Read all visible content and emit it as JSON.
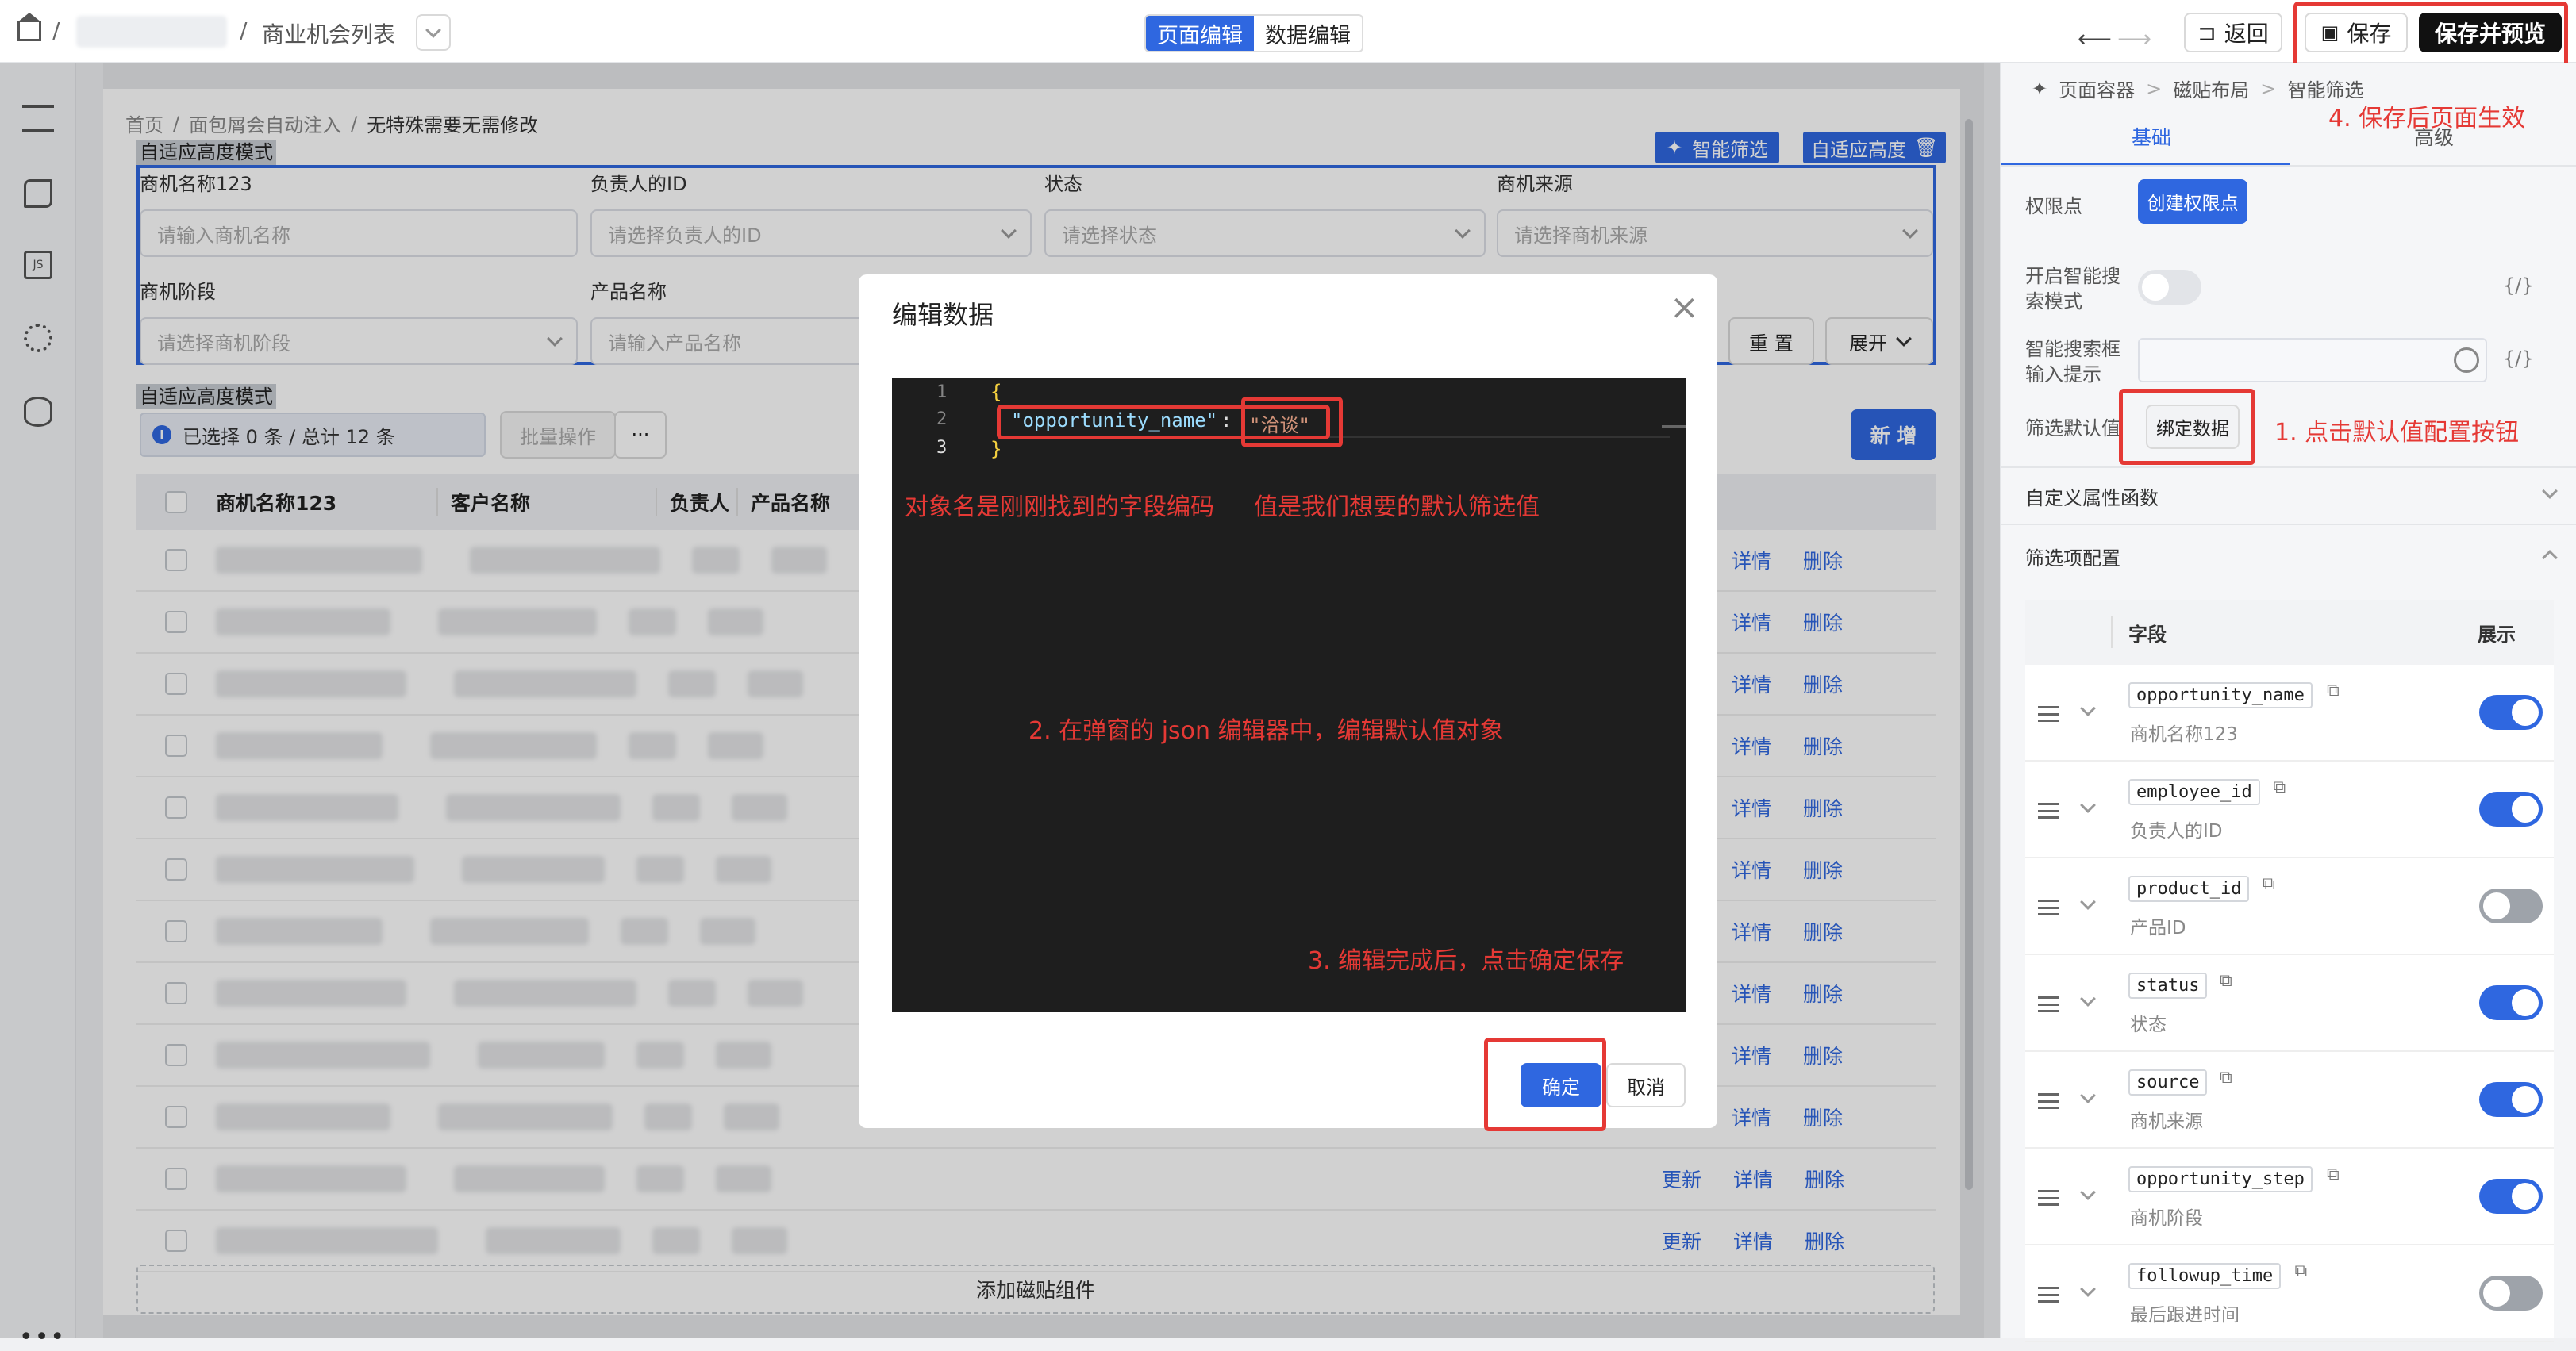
{
  "topbar": {
    "breadcrumb_sep1": "/",
    "breadcrumb_sep2": "/",
    "list_title": "商业机会列表",
    "tab_page_edit": "页面编辑",
    "tab_data_edit": "数据编辑",
    "back": "返回",
    "save": "保存",
    "save_preview": "保存并预览"
  },
  "leftbar": {
    "more": "•••"
  },
  "page": {
    "breadcrumb": [
      "首页",
      "面包屑会自动注入",
      "无特殊需要无需修改"
    ],
    "breadcrumb_sep": "/",
    "mode_label_1": "自适应高度模式",
    "mode_label_2": "自适应高度模式",
    "smart_filter_btn": "智能筛选",
    "adaptive_height_btn": "自适应高度",
    "form": {
      "f1_label": "商机名称123",
      "f1_ph": "请输入商机名称",
      "f2_label": "负责人的ID",
      "f2_ph": "请选择负责人的ID",
      "f3_label": "状态",
      "f3_ph": "请选择状态",
      "f4_label": "商机来源",
      "f4_ph": "请选择商机来源",
      "f5_label": "商机阶段",
      "f5_ph": "请选择商机阶段",
      "f6_label": "产品名称",
      "f6_ph": "请输入产品名称",
      "reset": "重 置",
      "expand": "展开"
    },
    "selection_info": "已选择 0 条 / 总计 12 条",
    "batch_ops": "批量操作",
    "batch_more": "···",
    "new_btn": "新 增",
    "table_headers": [
      "商机名称123",
      "客户名称",
      "负责人",
      "产品名称"
    ],
    "row_actions": {
      "update": "更新",
      "detail": "详情",
      "delete": "删除"
    },
    "add_tile": "添加磁贴组件"
  },
  "modal": {
    "title": "编辑数据",
    "close": "×",
    "line_numbers": [
      "1",
      "2",
      "3"
    ],
    "brace_open": "{",
    "json_key": "\"opportunity_name\"",
    "colon": ":",
    "json_value": "\"洽谈\"",
    "brace_close": "}",
    "note_key": "对象名是刚刚找到的字段编码",
    "note_value": "值是我们想要的默认筛选值",
    "note_step2": "2. 在弹窗的 json 编辑器中，编辑默认值对象",
    "note_step3": "3. 编辑完成后，点击确定保存",
    "confirm": "确定",
    "cancel": "取消"
  },
  "rpanel": {
    "breadcrumb": [
      "页面容器",
      "磁贴布局",
      "智能筛选"
    ],
    "breadcrumb_sep": ">",
    "tab_basic": "基础",
    "tab_advanced": "高级",
    "note_step4": "4. 保存后页面生效",
    "perm_label": "权限点",
    "perm_btn": "创建权限点",
    "smart_search_label": "开启智能搜索模式",
    "smart_search_hint_label": "智能搜索框输入提示",
    "code_icon": "{/}",
    "default_label": "筛选默认值",
    "bind_btn": "绑定数据",
    "note_step1": "1. 点击默认值配置按钮",
    "custom_fn": "自定义属性函数",
    "filter_config": "筛选项配置",
    "col_field": "字段",
    "col_show": "展示",
    "fields": [
      {
        "code": "opportunity_name",
        "label": "商机名称123",
        "on": true
      },
      {
        "code": "employee_id",
        "label": "负责人的ID",
        "on": true
      },
      {
        "code": "product_id",
        "label": "产品ID",
        "on": false
      },
      {
        "code": "status",
        "label": "状态",
        "on": true
      },
      {
        "code": "source",
        "label": "商机来源",
        "on": true
      },
      {
        "code": "opportunity_step",
        "label": "商机阶段",
        "on": true
      },
      {
        "code": "followup_time",
        "label": "最后跟进时间",
        "on": false
      }
    ]
  }
}
